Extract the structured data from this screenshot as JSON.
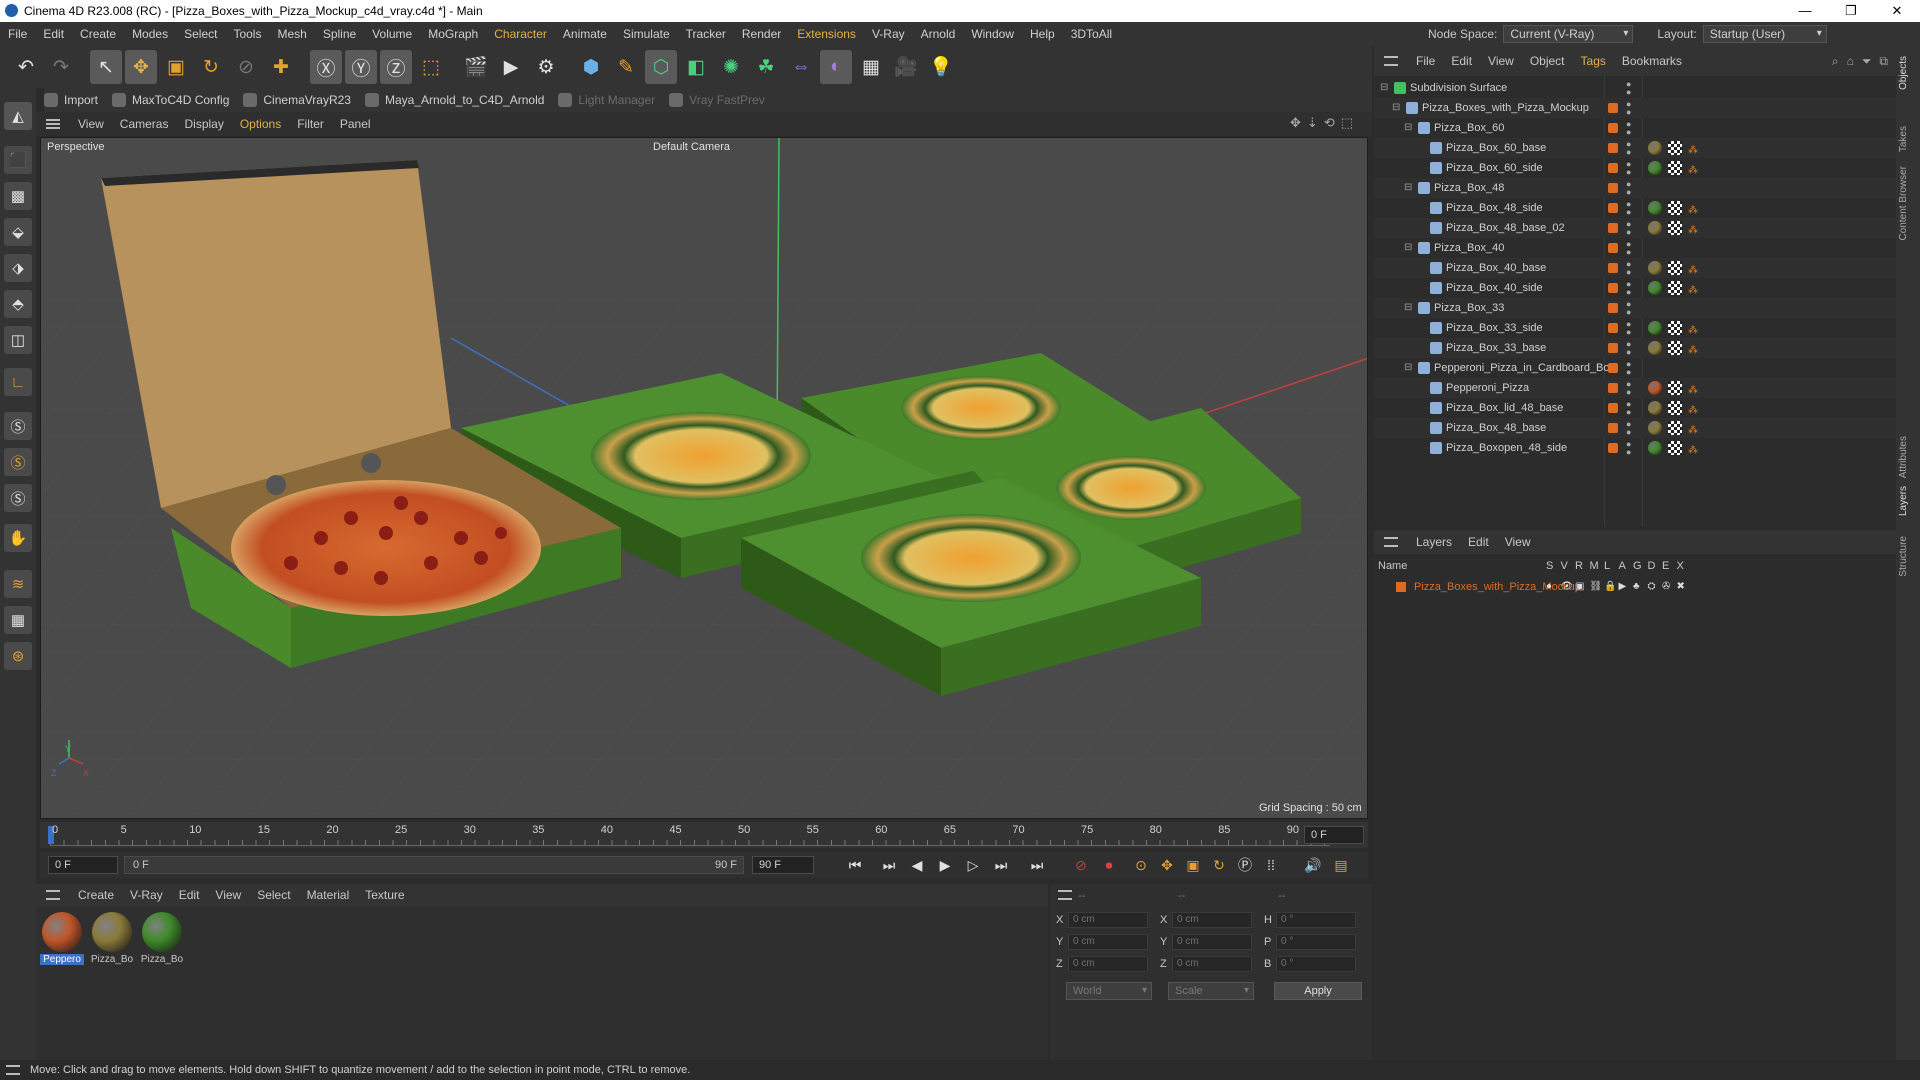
{
  "window": {
    "title": "Cinema 4D R23.008 (RC) - [Pizza_Boxes_with_Pizza_Mockup_c4d_vray.c4d *] - Main",
    "min": "—",
    "max": "❐",
    "close": "✕"
  },
  "menu": [
    "File",
    "Edit",
    "Create",
    "Modes",
    "Select",
    "Tools",
    "Mesh",
    "Spline",
    "Volume",
    "MoGraph",
    "Character",
    "Animate",
    "Simulate",
    "Tracker",
    "Render",
    "Extensions",
    "V-Ray",
    "Arnold",
    "Window",
    "Help",
    "3DToAll"
  ],
  "menu_highlight": [
    "Character",
    "Extensions"
  ],
  "nodespace": {
    "label": "Node Space:",
    "value": "Current (V-Ray)"
  },
  "layout": {
    "label": "Layout:",
    "value": "Startup (User)"
  },
  "plugins": [
    {
      "label": "Import",
      "disabled": false
    },
    {
      "label": "MaxToC4D Config",
      "disabled": false
    },
    {
      "label": "CinemaVrayR23",
      "disabled": false
    },
    {
      "label": "Maya_Arnold_to_C4D_Arnold",
      "disabled": false
    },
    {
      "label": "Light Manager",
      "disabled": true
    },
    {
      "label": "Vray FastPrev",
      "disabled": true
    }
  ],
  "viewport_menu": [
    "View",
    "Cameras",
    "Display",
    "Options",
    "Filter",
    "Panel"
  ],
  "viewport": {
    "name": "Perspective",
    "camera": "Default Camera",
    "grid_spacing": "Grid Spacing : 50 cm",
    "axis_x": "X",
    "axis_y": "Y",
    "axis_z": "Z"
  },
  "timeline": {
    "ticks": [
      "0",
      "5",
      "10",
      "15",
      "20",
      "25",
      "30",
      "35",
      "40",
      "45",
      "50",
      "55",
      "60",
      "65",
      "70",
      "75",
      "80",
      "85",
      "90"
    ],
    "end_frame": "0 F"
  },
  "transport": {
    "start": "0 F",
    "current": "0 F",
    "range_end": "90 F",
    "max": "90 F"
  },
  "material_menu": [
    "Create",
    "V-Ray",
    "Edit",
    "View",
    "Select",
    "Material",
    "Texture"
  ],
  "materials": [
    {
      "name": "Peppero",
      "color": "#c0562a",
      "selected": true
    },
    {
      "name": "Pizza_Bo",
      "color": "#8a7a3a",
      "selected": false
    },
    {
      "name": "Pizza_Bo",
      "color": "#3e8a2a",
      "selected": false
    }
  ],
  "attributes": {
    "header1": "--",
    "header2": "--",
    "header3": "--",
    "rows": [
      {
        "a": "X",
        "av": "0 cm",
        "b": "X",
        "bv": "0 cm",
        "c": "H",
        "cv": "0 °"
      },
      {
        "a": "Y",
        "av": "0 cm",
        "b": "Y",
        "bv": "0 cm",
        "c": "P",
        "cv": "0 °"
      },
      {
        "a": "Z",
        "av": "0 cm",
        "b": "Z",
        "bv": "0 cm",
        "c": "B",
        "cv": "0 °"
      }
    ],
    "coord": "World",
    "mode": "Scale",
    "apply": "Apply"
  },
  "status": "Move: Click and drag to move elements. Hold down SHIFT to quantize movement / add to the selection in point mode, CTRL to remove.",
  "object_menu": [
    "File",
    "Edit",
    "View",
    "Object",
    "Tags",
    "Bookmarks"
  ],
  "objects": [
    {
      "name": "Subdivision Surface",
      "indent": 0,
      "mat": ""
    },
    {
      "name": "Pizza_Boxes_with_Pizza_Mockup",
      "indent": 1,
      "mat": ""
    },
    {
      "name": "Pizza_Box_60",
      "indent": 2,
      "mat": ""
    },
    {
      "name": "Pizza_Box_60_base",
      "indent": 3,
      "mat": "#8a7a3a"
    },
    {
      "name": "Pizza_Box_60_side",
      "indent": 3,
      "mat": "#3e8a2a"
    },
    {
      "name": "Pizza_Box_48",
      "indent": 2,
      "mat": ""
    },
    {
      "name": "Pizza_Box_48_side",
      "indent": 3,
      "mat": "#3e8a2a"
    },
    {
      "name": "Pizza_Box_48_base_02",
      "indent": 3,
      "mat": "#8a7a3a"
    },
    {
      "name": "Pizza_Box_40",
      "indent": 2,
      "mat": ""
    },
    {
      "name": "Pizza_Box_40_base",
      "indent": 3,
      "mat": "#8a7a3a"
    },
    {
      "name": "Pizza_Box_40_side",
      "indent": 3,
      "mat": "#3e8a2a"
    },
    {
      "name": "Pizza_Box_33",
      "indent": 2,
      "mat": ""
    },
    {
      "name": "Pizza_Box_33_side",
      "indent": 3,
      "mat": "#3e8a2a"
    },
    {
      "name": "Pizza_Box_33_base",
      "indent": 3,
      "mat": "#8a7a3a"
    },
    {
      "name": "Pepperoni_Pizza_in_Cardboard_Box",
      "indent": 2,
      "mat": ""
    },
    {
      "name": "Pepperoni_Pizza",
      "indent": 3,
      "mat": "#c0562a"
    },
    {
      "name": "Pizza_Box_lid_48_base",
      "indent": 3,
      "mat": "#8a7a3a"
    },
    {
      "name": "Pizza_Box_48_base",
      "indent": 3,
      "mat": "#8a7a3a"
    },
    {
      "name": "Pizza_Boxopen_48_side",
      "indent": 3,
      "mat": "#3e8a2a"
    }
  ],
  "layers_menu": [
    "Layers",
    "Edit",
    "View"
  ],
  "layers_header": {
    "name": "Name",
    "cols": [
      "S",
      "V",
      "R",
      "M",
      "L",
      "A",
      "G",
      "D",
      "E",
      "X"
    ]
  },
  "layers": [
    {
      "name": "Pizza_Boxes_with_Pizza_Mockup",
      "color": "#e06a20"
    }
  ],
  "side_tabs": [
    "Objects",
    "Takes",
    "Content Browser",
    "Attributes",
    "Layers",
    "Structure"
  ],
  "colors": {
    "accent": "#e4b04a",
    "layer_text": "#e06a20",
    "selection": "#3c6fc6"
  }
}
